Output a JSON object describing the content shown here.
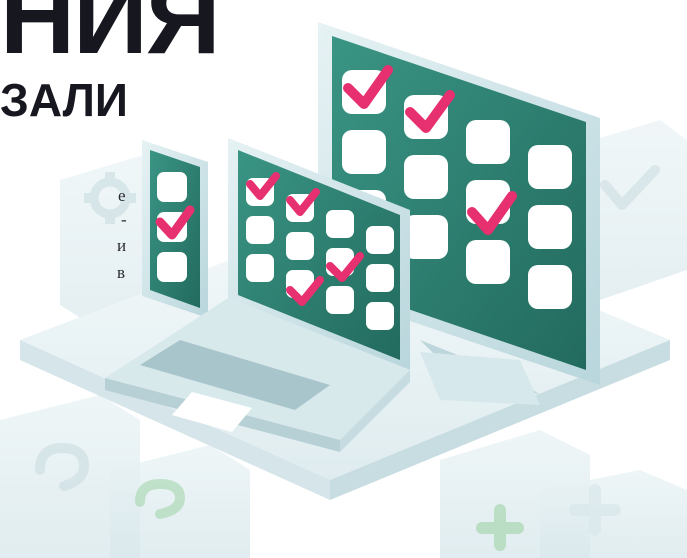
{
  "heading": {
    "line1": "НИЯ",
    "line2": "ЗАЛИ"
  },
  "text_fragments": [
    "е",
    "-",
    "и",
    "в"
  ],
  "illustration": {
    "devices": [
      "phone",
      "laptop",
      "monitor"
    ],
    "colors": {
      "screen": "#2e8273",
      "screen_dark": "#1d5d52",
      "tile": "#ffffff",
      "check": "#e6306f",
      "platform": "#eef5f7",
      "device_frame": "#cfe6ea",
      "bg_cube": "#e3eef1"
    },
    "bg_icons": [
      "gear-icon",
      "check-icon",
      "question-icon",
      "plus-icon",
      "cross-icon"
    ]
  }
}
